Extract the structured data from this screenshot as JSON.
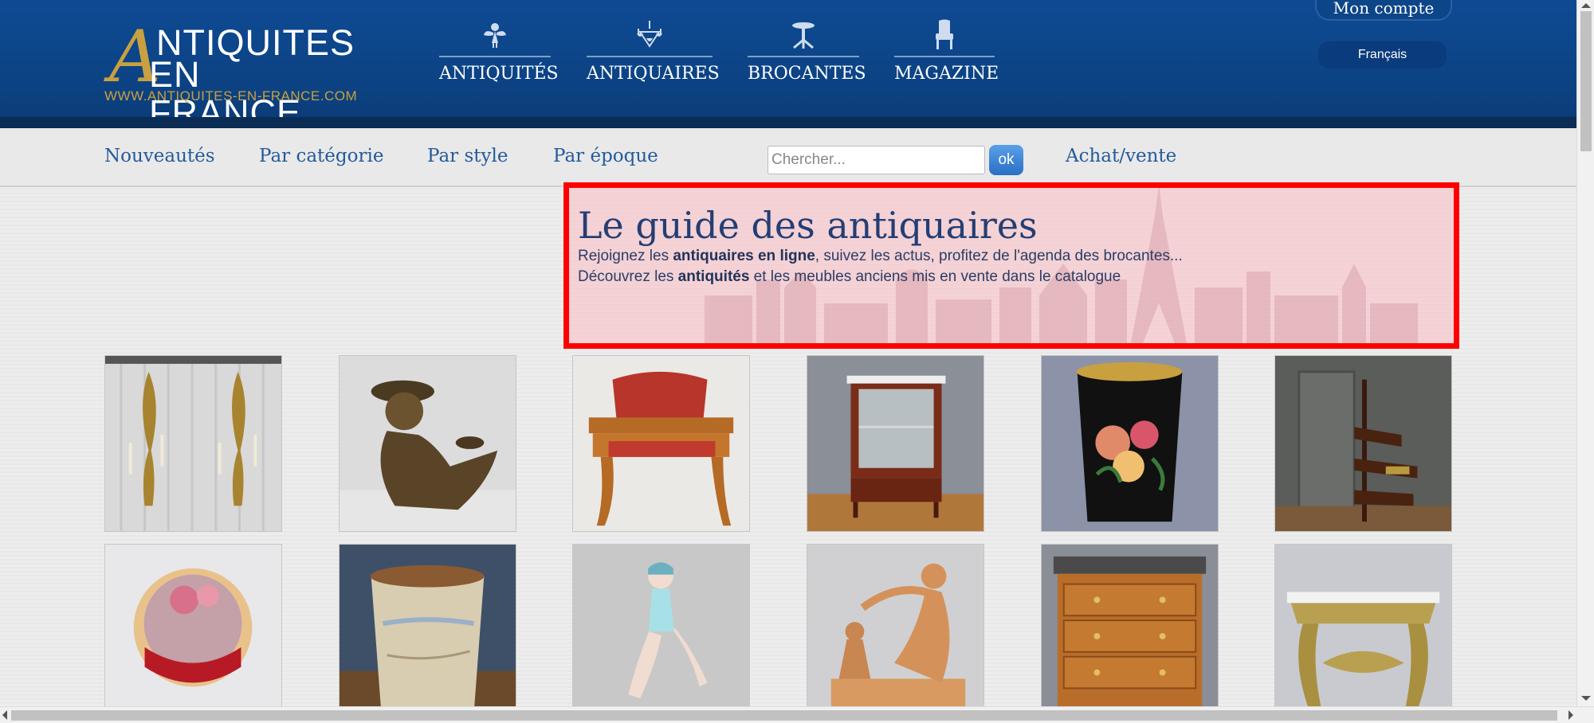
{
  "header": {
    "logo_big_letter": "A",
    "logo_line1": "NTIQUITES",
    "logo_line2": "EN FRANCE",
    "logo_url": "WWW.ANTIQUITES-EN-FRANCE.COM",
    "nav": [
      {
        "label": "ANTIQUITÉS",
        "icon": "cherub-icon"
      },
      {
        "label": "ANTIQUAIRES",
        "icon": "chandelier-icon"
      },
      {
        "label": "BROCANTES",
        "icon": "pedestal-table-icon"
      },
      {
        "label": "MAGAZINE",
        "icon": "armchair-icon"
      }
    ],
    "account_label": "Mon compte",
    "language_label": "Français"
  },
  "subnav": {
    "links": [
      "Nouveautés",
      "Par catégorie",
      "Par style",
      "Par époque"
    ],
    "search_placeholder": "Chercher...",
    "search_button": "ok",
    "buy_sell": "Achat/vente"
  },
  "hero": {
    "title": "Le guide des antiquaires",
    "line1_pre": "Rejoignez les ",
    "line1_bold": "antiquaires en ligne",
    "line1_post": ", suivez les actus, profitez de l'agenda des brocantes...",
    "line2_pre": "Découvrez les ",
    "line2_bold": "antiquités",
    "line2_post": " et les meubles anciens mis en vente dans le catalogue"
  },
  "products": [
    {
      "name": "gilded-wall-sconces-pair"
    },
    {
      "name": "bronze-child-statue"
    },
    {
      "name": "writing-desk-red-leather"
    },
    {
      "name": "mahogany-display-cabinet"
    },
    {
      "name": "painted-floral-wastebasket"
    },
    {
      "name": "spiral-library-steps"
    },
    {
      "name": "enamel-portrait-box"
    },
    {
      "name": "map-wastebasket"
    },
    {
      "name": "porcelain-bather-figurine"
    },
    {
      "name": "terracotta-woman-sculpture"
    },
    {
      "name": "burl-chest-of-drawers"
    },
    {
      "name": "gilded-console-table"
    }
  ],
  "colors": {
    "header_blue": "#0c4282",
    "gold": "#c9a040",
    "link_blue": "#245a9b",
    "highlight_red": "#ff0000"
  }
}
